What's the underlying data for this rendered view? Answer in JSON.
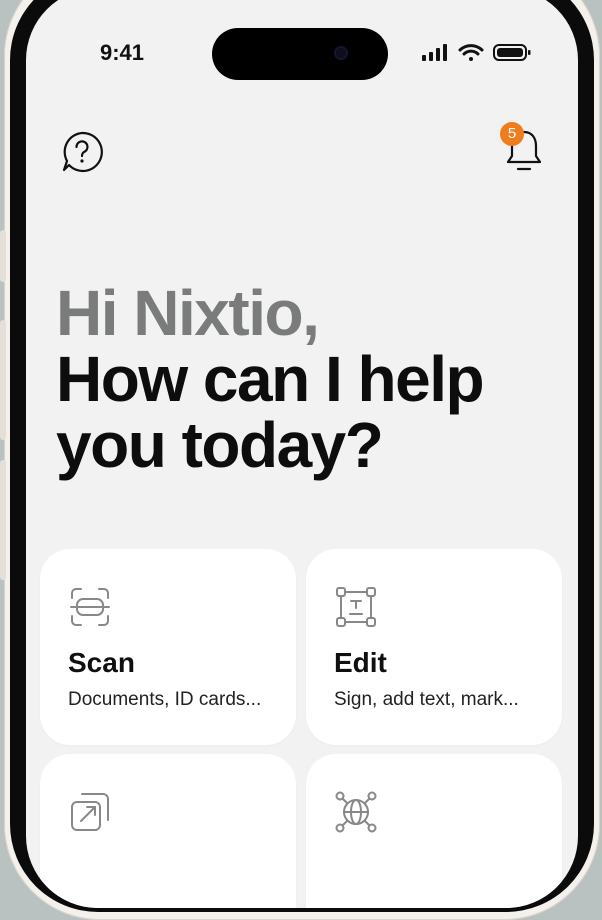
{
  "status_bar": {
    "time": "9:41",
    "icons": [
      "signal-icon",
      "wifi-icon",
      "battery-icon"
    ]
  },
  "header": {
    "help_icon": "question-circle-icon",
    "notification_icon": "bell-icon",
    "notification_count": "5",
    "badge_color": "#f07d1d"
  },
  "greeting": {
    "name_line": "Hi Nixtio,",
    "prompt_line_1": "How can I help",
    "prompt_line_2": "you today?"
  },
  "cards": [
    {
      "title": "Scan",
      "subtitle": "Documents, ID cards...",
      "icon": "scan-frame-icon"
    },
    {
      "title": "Edit",
      "subtitle": "Sign, add text, mark...",
      "icon": "text-edit-icon"
    },
    {
      "title": "",
      "subtitle": "",
      "icon": "export-arrow-icon"
    },
    {
      "title": "",
      "subtitle": "",
      "icon": "globe-network-icon"
    }
  ],
  "colors": {
    "screen_background": "#f2f2f2",
    "card_background": "#ffffff",
    "greeting_muted": "#7a7c7b",
    "text_primary": "#0d0d0d"
  }
}
